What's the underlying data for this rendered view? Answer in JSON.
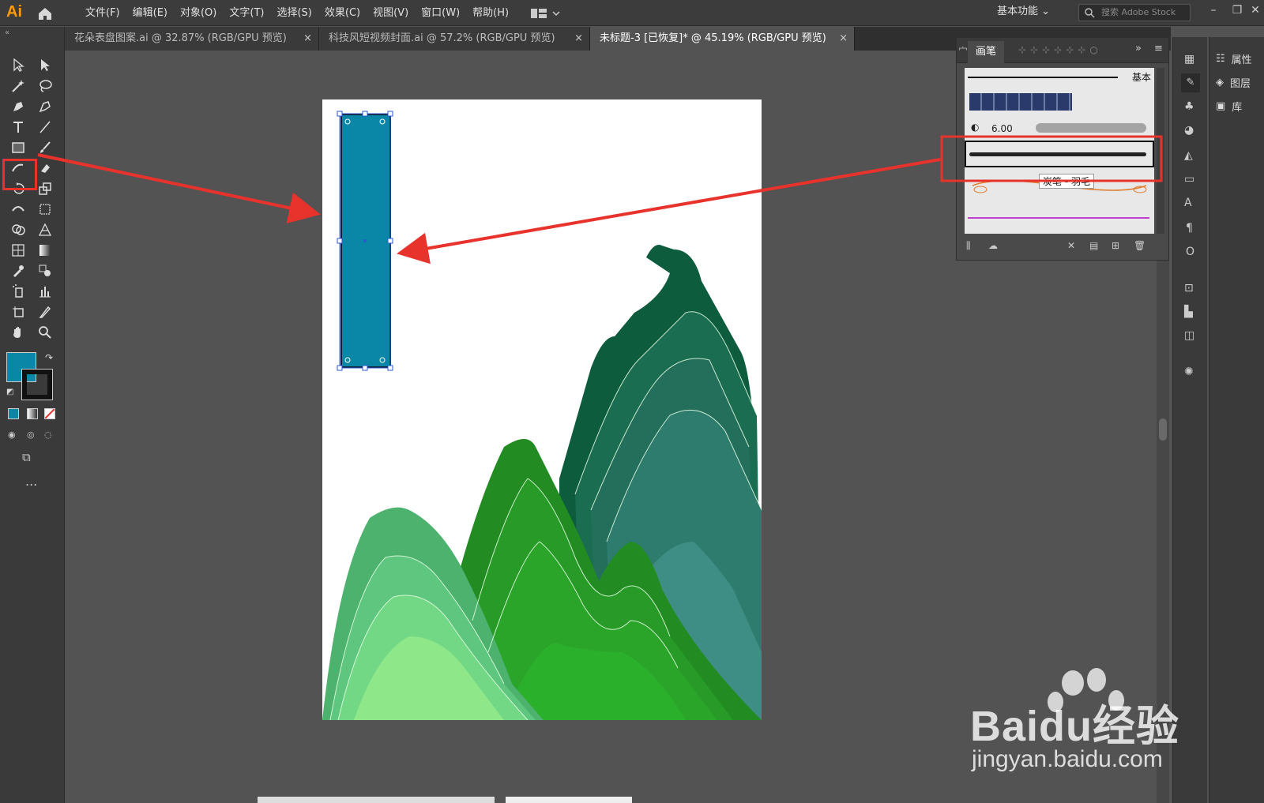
{
  "app": {
    "logo": "Ai",
    "menu": [
      "文件(F)",
      "编辑(E)",
      "对象(O)",
      "文字(T)",
      "选择(S)",
      "效果(C)",
      "视图(V)",
      "窗口(W)",
      "帮助(H)"
    ],
    "workspace": "基本功能",
    "stock_search_placeholder": "搜索 Adobe Stock"
  },
  "tabs": [
    {
      "label": "花朵表盘图案.ai @ 32.87% (RGB/GPU 预览)",
      "close": "×"
    },
    {
      "label": "科技风短视频封面.ai @ 57.2% (RGB/GPU 预览)",
      "close": "×"
    },
    {
      "label": "未标题-3 [已恢复]* @ 45.19% (RGB/GPU 预览)",
      "close": "×"
    }
  ],
  "colors": {
    "fill": "#0a87a6",
    "stroke": "#111111",
    "highlight": "#e8322c",
    "mountain_dark": "#0e5c3e",
    "mountain_mid": "#228c22",
    "mountain_light": "#8ee88a"
  },
  "brush_panel": {
    "active_tab": "画笔",
    "basic_label": "基本",
    "size_label": "6.00",
    "tooltip": "炭笔 - 羽毛"
  },
  "right_panel": {
    "items": [
      "属性",
      "图层",
      "库"
    ]
  },
  "watermark": {
    "brand": "Baidu经验",
    "url": "jingyan.baidu.com"
  },
  "toolbar": {
    "more_label": "..."
  }
}
